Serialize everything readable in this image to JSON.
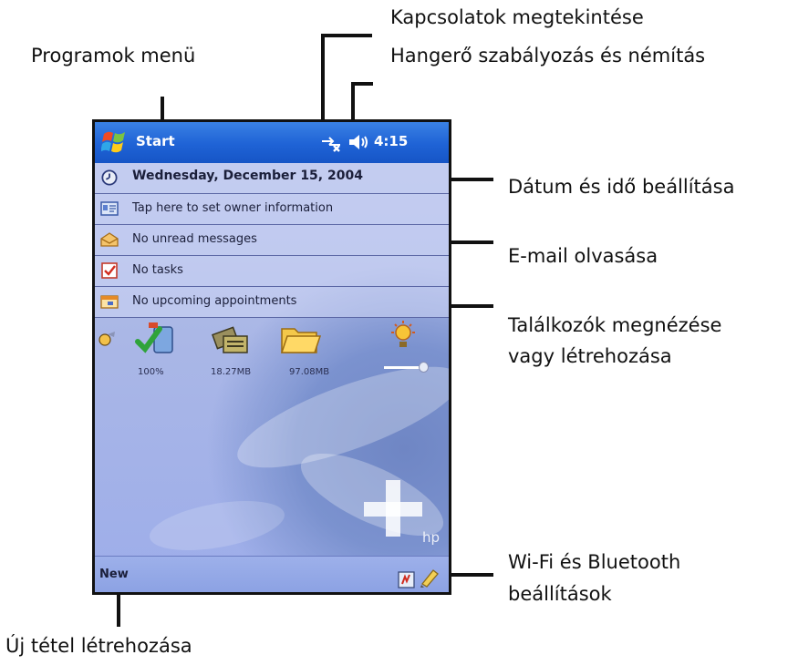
{
  "callouts": {
    "programs_menu": "Programok menü",
    "connections": "Kapcsolatok megtekintése",
    "volume": "Hangerő szabályozás és némítás",
    "date_time": "Dátum és idő beállítása",
    "email": "E-mail olvasása",
    "appointments_line1": "Találkozók megnézése",
    "appointments_line2": "vagy létrehozása",
    "wireless_line1": "Wi-Fi és Bluetooth",
    "wireless_line2": "beállítások",
    "new_item": "Új tétel létrehozása"
  },
  "device": {
    "titlebar": {
      "start_label": "Start",
      "time": "4:15"
    },
    "today_items": [
      {
        "label": "Wednesday, December 15, 2004",
        "icon": "clock-icon"
      },
      {
        "label": "Tap here to set owner information",
        "icon": "owner-card-icon"
      },
      {
        "label": "No unread messages",
        "icon": "envelope-icon"
      },
      {
        "label": "No tasks",
        "icon": "task-check-icon"
      },
      {
        "label": "No upcoming appointments",
        "icon": "calendar-icon"
      }
    ],
    "status": {
      "battery": "100%",
      "main_memory": "18.27MB",
      "storage": "97.08MB"
    },
    "bottombar": {
      "new_label": "New"
    },
    "colors": {
      "titlebar": "#1f63d6",
      "background": "#aab7e6"
    }
  }
}
